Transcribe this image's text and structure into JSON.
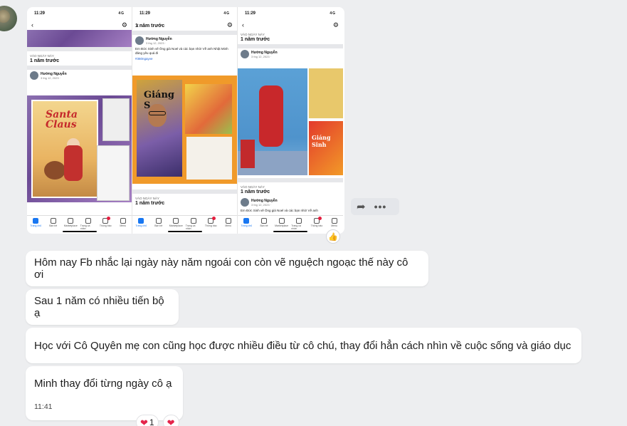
{
  "phone_screens": [
    {
      "time": "11:29",
      "signal": "4G",
      "memory_label": "VÀO NGÀY NÀY",
      "memory_title": "1 năm trước",
      "poster": "Hường Nguyễn",
      "post_date": "3 thg 12, 2023 · ",
      "artwork_text": "Santa Claus"
    },
    {
      "time": "11:29",
      "signal": "4G",
      "memory_label": "VÀO NGÀY NÀY",
      "memory_title": "1 năm trước",
      "poster": "Hường Nguyễn",
      "post_date": "3 thg 12, 2023 · ",
      "post_text": "Em Đức Sinh vẽ Ông già Noel và các bạn nhỏ! Về anh Nhật Minh đáng yêu quá đi",
      "hashtag": "#360ngayve",
      "artwork_text": "Giáng S"
    },
    {
      "time": "11:29",
      "signal": "4G",
      "memory_label": "VÀO NGÀY NÀY",
      "memory_title": "1 năm trước",
      "poster": "Hường Nguyễn",
      "post_date": "3 thg 12, 2023 · ",
      "post_text": "Em Đức Sinh vẽ Ông già Noel và các bạn nhỏ! Về anh",
      "artwork_text": "Giáng Sinh"
    }
  ],
  "bottom_nav": [
    "Trang chủ",
    "Bạn bè",
    "Marketplace",
    "Trang cá nhân",
    "Thông báo",
    "Menu"
  ],
  "messages": [
    {
      "text": "Hôm nay Fb nhắc lại ngày này năm ngoái con còn vẽ nguệch ngoạc thế này cô ơi"
    },
    {
      "text": "Sau 1 năm có nhiều tiến bộ ạ"
    },
    {
      "text": "Học với Cô Quyên mẹ con cũng học được nhiều điều từ cô chú, thay đổi hẳn cách nhìn về cuộc sống và giáo dục"
    },
    {
      "text": "Minh thay đổi từng ngày cô ạ",
      "time": "11:41"
    }
  ],
  "reactions": {
    "heart_count": "1"
  },
  "colors": {
    "background": "#edeef0",
    "bubble": "#ffffff",
    "fb_blue": "#1877f2",
    "heart": "#e4254b"
  },
  "icons": [
    "back-arrow-icon",
    "gear-icon",
    "share-icon",
    "more-icon",
    "thumbs-up-icon",
    "heart-icon"
  ]
}
